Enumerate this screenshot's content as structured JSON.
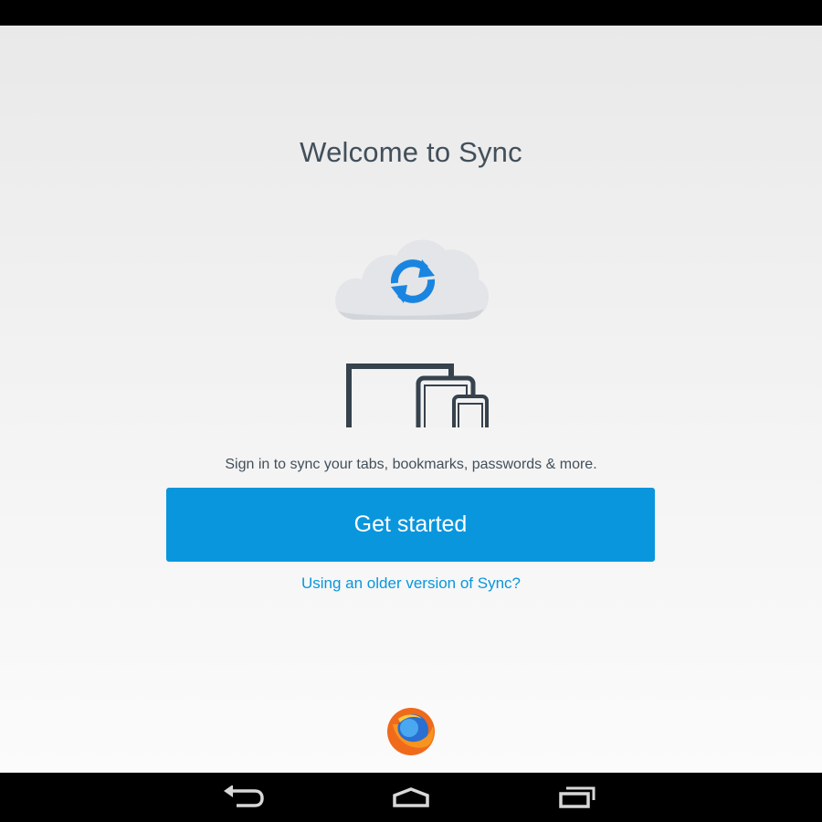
{
  "page": {
    "title": "Welcome to Sync",
    "tagline": "Sign in to sync your tabs, bookmarks, passwords & more.",
    "get_started_label": "Get started",
    "older_version_link": "Using an older version of Sync?"
  },
  "icons": {
    "hero": [
      "cloud-icon",
      "sync-icon",
      "laptop-icon",
      "tablet-icon",
      "phone-icon"
    ],
    "logo": "firefox-logo",
    "navigation": [
      "back-icon",
      "home-icon",
      "recent-apps-icon"
    ]
  },
  "colors": {
    "accent": "#0996dd",
    "text": "#424f5a",
    "device_outline": "#36424c",
    "cloud": "#e3e5e8"
  }
}
